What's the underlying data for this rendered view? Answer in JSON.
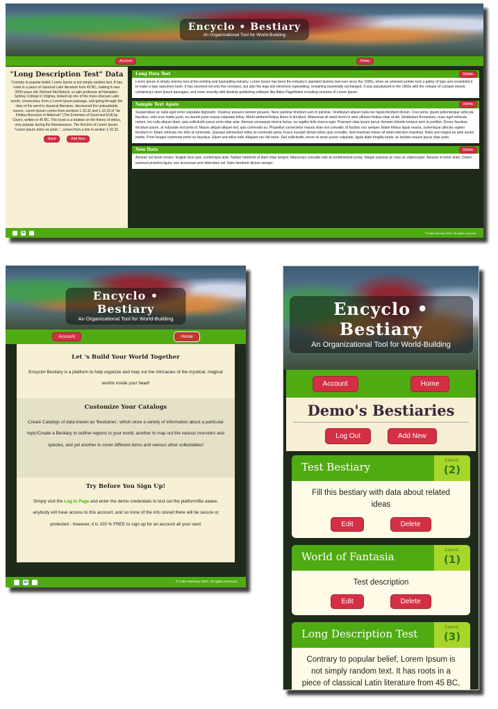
{
  "brand": {
    "title": "Encyclo • Bestiary",
    "subtitle": "An Organizational Tool for World-Building"
  },
  "nav": {
    "account": "Account",
    "home": "Home"
  },
  "colors": {
    "green": "#4fab12",
    "red": "#d32f45",
    "cream": "#f7f0d5",
    "dark": "#1f2a1a",
    "lime": "#a8d52a"
  },
  "footer": {
    "copyright": "© Kalin Ramsey 2020. All rights reserved.",
    "icons": [
      "github-icon",
      "linkedin-icon",
      "email-icon"
    ]
  },
  "detail": {
    "heading": "\"Long Description Test\" Data",
    "description": "Contrary to popular belief, Lorem Ipsum is not simply random text. It has roots in a piece of classical Latin literature from 45 BC, making it over 2000 years old. Richard McClintock, a Latin professor at Hampden-Sydney College in Virginia, looked up one of the more obscure Latin words, consectetur, from a Lorem Ipsum passage, and going through the cites of the word in classical literature, discovered the undoubtable source. Lorem Ipsum comes from sections 1.10.32 and 1.10.33 of \"de Finibus Bonorum et Malorum\" (The Extremes of Good and Evil) by Cicero, written in 45 BC. This book is a treatise on the theory of ethics, very popular during the Renaissance. The first line of Lorem Ipsum, \"Lorem ipsum dolor sit amet..\", comes from a line in section 1.10.32.",
    "back": "Back",
    "add_new": "Add New",
    "delete_label": "Delete",
    "items": [
      {
        "title": "Long Data Test",
        "body": "Lorem Ipsum is simply dummy text of the printing and typesetting industry. Lorem Ipsum has been the industry's standard dummy text ever since the 1500s, when an unknown printer took a galley of type and scrambled it to make a type specimen book. It has survived not only five centuries, but also the leap into electronic typesetting, remaining essentially unchanged. It was popularised in the 1960s with the release of Letraset sheets containing Lorem Ipsum passages, and more recently with desktop publishing software like Aldus PageMaker including versions of Lorem Ipsum."
      },
      {
        "title": "Sample Text Again",
        "body": "Suspendisse ac nulla eget tortor vulputate dignissim. Vivamus posuere laoreet posuere. Nunc pulvinar tincidunt sem in pulvinar. Vestibulum aliquet nulla nec ligula tincidunt dictum. Cras porta, ipsum pellentesque vehicula faucibus, odio eros mattis justo, eu laoreet justo massa vulputate tellus. Morbi eleifend finibus libero in tincidunt. Maecenas sit amet lorem in ante ultricies finibus vitae at elit. Vestibulum fermentum, nunc eget vehicula rutrum, leo nulla aliquet diam, quis sollicitudin purus enim vitae ante. Aenean consequat viverra lectus, eu sagittis felis viverra eget. Praesent vitae ipsum purus. Aenean lobortis tempus sem ut porttitor. Donec faucibus tincidunt ipsum, at vulputate nisl porta id. Mauris aliquet aliquet nisl, quis commodo eu. Phasellus consectetur mauris vitae nisl convallis, id facilisis orci semper. Etiam finibus ligula massa, scelerisque ultricies sapien tincidunt in. Etiam vehicula nec felis at commodo. Quisque elementum tellus at commodo porta. Fusce suscipit dictum tellus quis convallis. Sed maximus metus sit amet interdum maximus. Nulla sed magna eu ante auctor mattis. Proin feugiat commodo tortor eu faucibus. Etiam sed tellus velit. Aliquam nec elit tortor. Sed sollicitudin, lorem sit amet auctor vulputate, ligula diam fringilla turpis, ac facilisis mauris purus vitae justo."
      },
      {
        "title": "New Data",
        "body": "Aenean vel lorem ornare, feugiat risus quis, scelerisque ante. Nullam hendrerit ut diam vitae tempor. Maecenas convallis velit at condimentum porta. Integer pulvinar ac nunc ac ullamcorper. Aenean et tortor enim. Donec euismod pharetra ligula, non accumsan sem bibendum vel. Nam hendrerit dictum semper."
      }
    ]
  },
  "landing": {
    "s1_title": "Let 's Build Your World Together",
    "s1_text": "Encyclo• Bestiary is a platform to help organize and map out the intricacies of the mystical, magical worlds inside your head!",
    "s2_title": "Customize Your Catalogs",
    "s2_text": "Create Catalogs of data known as 'Bestiaries', which store a variety of information about a particular topic!Create a Bestiary to outline regions in your world, another to map out the various monsters and species, and yet another to cover different items and various other collectables!",
    "s3_title": "Try Before You Sign Up!",
    "s3_pre": "Simply visit the ",
    "s3_link": "Log In Page",
    "s3_post": " and enter the demo credentials to test out the platform!Be aware, anybody will have access to this account, and so none of the info stored there will be secure or protected - however, it is 100 % FREE to sign up for an account all your own!"
  },
  "dashboard": {
    "heading": "Demo's Bestiaries",
    "logout": "Log Out",
    "add_new": "Add New",
    "count_label": "Count:",
    "edit_label": "Edit",
    "delete_label": "Delete",
    "bestiaries": [
      {
        "title": "Test Bestiary",
        "count": "(2)",
        "desc": "Fill this bestiary with data about related ideas"
      },
      {
        "title": "World of Fantasia",
        "count": "(1)",
        "desc": "Test description"
      },
      {
        "title": "Long Description Test",
        "count": "(3)",
        "desc": "Contrary to popular belief, Lorem Ipsum is not simply random text. It has roots in a piece of classical Latin literature from 45 BC,"
      }
    ]
  }
}
